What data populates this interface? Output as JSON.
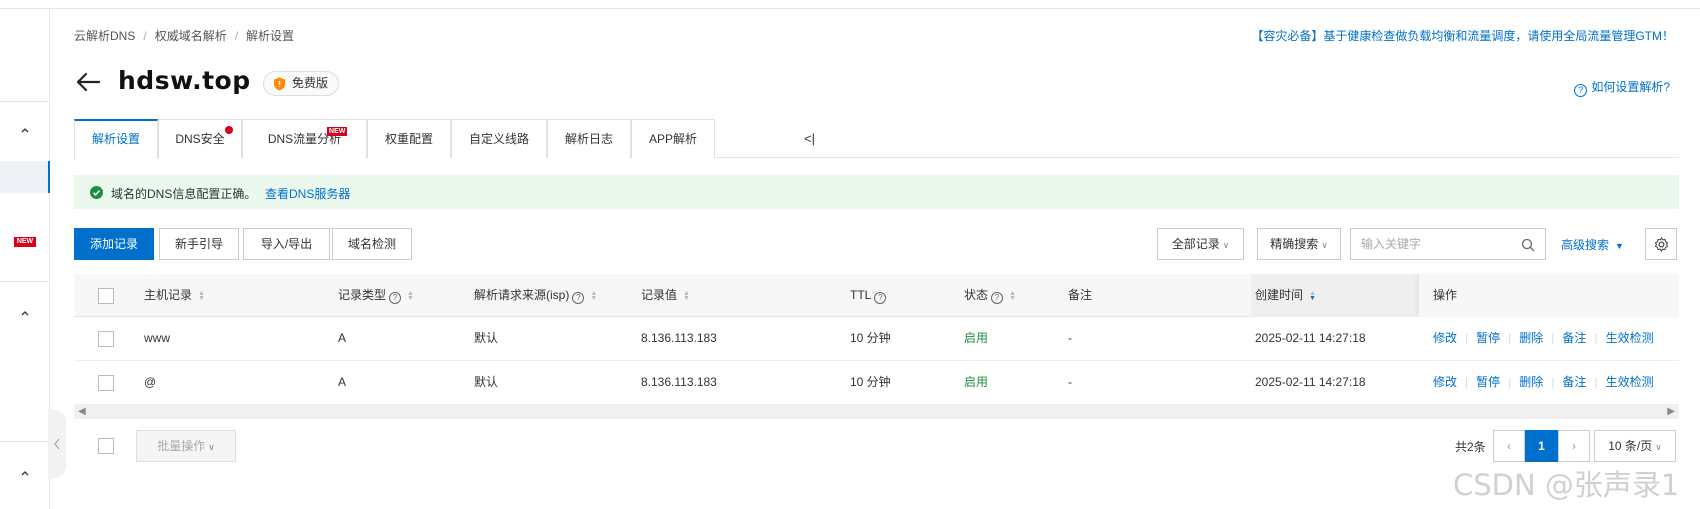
{
  "breadcrumb": [
    "云解析DNS",
    "权威域名解析",
    "解析设置"
  ],
  "promo": "【容灾必备】基于健康检查做负载均衡和流量调度，请使用全局流量管理GTM！",
  "domain": "hdsw.top",
  "edition": "免费版",
  "help_link": "如何设置解析?",
  "tabs": [
    {
      "label": "解析设置"
    },
    {
      "label": "DNS安全"
    },
    {
      "label": "DNS流量分析",
      "badge": "NEW"
    },
    {
      "label": "权重配置"
    },
    {
      "label": "自定义线路"
    },
    {
      "label": "解析日志"
    },
    {
      "label": "APP解析"
    }
  ],
  "tab_more": "<|",
  "rail": {
    "badge": "NEW"
  },
  "notice": {
    "text": "域名的DNS信息配置正确。",
    "link": "查看DNS服务器"
  },
  "toolbar": {
    "add": "添加记录",
    "guide": "新手引导",
    "import_export": "导入/导出",
    "check": "域名检测",
    "filter": "全部记录",
    "mode": "精确搜索",
    "search_placeholder": "输入关键字",
    "advanced": "高级搜索"
  },
  "columns": {
    "host": "主机记录",
    "type": "记录类型",
    "isp": "解析请求来源(isp)",
    "value": "记录值",
    "ttl": "TTL",
    "status": "状态",
    "remark": "备注",
    "created": "创建时间",
    "ops": "操作"
  },
  "rows": [
    {
      "host": "www",
      "type": "A",
      "isp": "默认",
      "value": "8.136.113.183",
      "ttl": "10 分钟",
      "status": "启用",
      "remark": "-",
      "created": "2025-02-11 14:27:18"
    },
    {
      "host": "@",
      "type": "A",
      "isp": "默认",
      "value": "8.136.113.183",
      "ttl": "10 分钟",
      "status": "启用",
      "remark": "-",
      "created": "2025-02-11 14:27:18"
    }
  ],
  "ops": [
    "修改",
    "暂停",
    "删除",
    "备注",
    "生效检测"
  ],
  "batch": "批量操作",
  "pagination": {
    "total": "共2条",
    "current": "1",
    "size": "10 条/页"
  },
  "watermark": "CSDN @张声录1",
  "colors": {
    "primary": "#0070cc",
    "success": "#1e8e3e",
    "notice_bg": "#eaf8ee",
    "badge": "#d9001b"
  }
}
